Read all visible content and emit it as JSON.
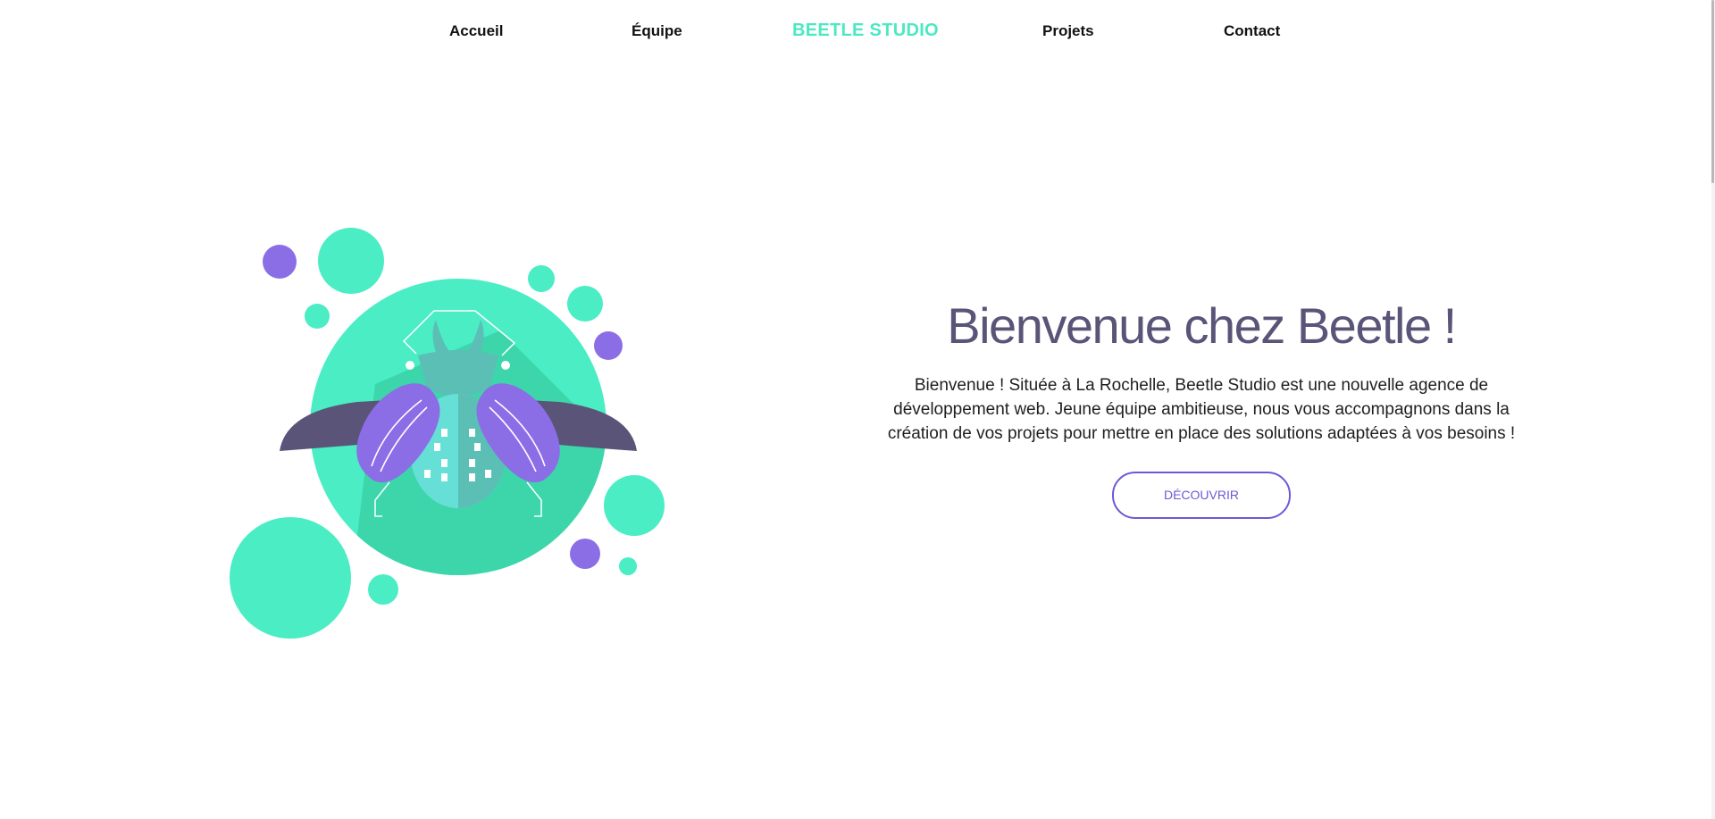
{
  "nav": {
    "items": [
      {
        "label": "Accueil"
      },
      {
        "label": "Équipe"
      },
      {
        "label": "BEETLE STUDIO"
      },
      {
        "label": "Projets"
      },
      {
        "label": "Contact"
      }
    ]
  },
  "hero": {
    "title": "Bienvenue chez Beetle !",
    "description": "Bienvenue ! Située à La Rochelle, Beetle Studio est une nouvelle agence de développement web. Jeune équipe ambitieuse, nous vous accompagnons dans la création de vos projets pour mettre en place des solutions adaptées à vos besoins !",
    "button_label": "DÉCOUVRIR"
  },
  "illustration": {
    "icon": "beetle-illustration",
    "colors": {
      "mint": "#4bedc4",
      "mint_dark": "#3dd6ab",
      "purple": "#8b6ee6",
      "dark_wing": "#5a5478",
      "body": "#5bbfb6",
      "belly": "#66dfd6"
    }
  },
  "theme": {
    "brand_color": "#4be9c2",
    "title_color": "#5a5478",
    "button_color": "#6b5ad6"
  }
}
